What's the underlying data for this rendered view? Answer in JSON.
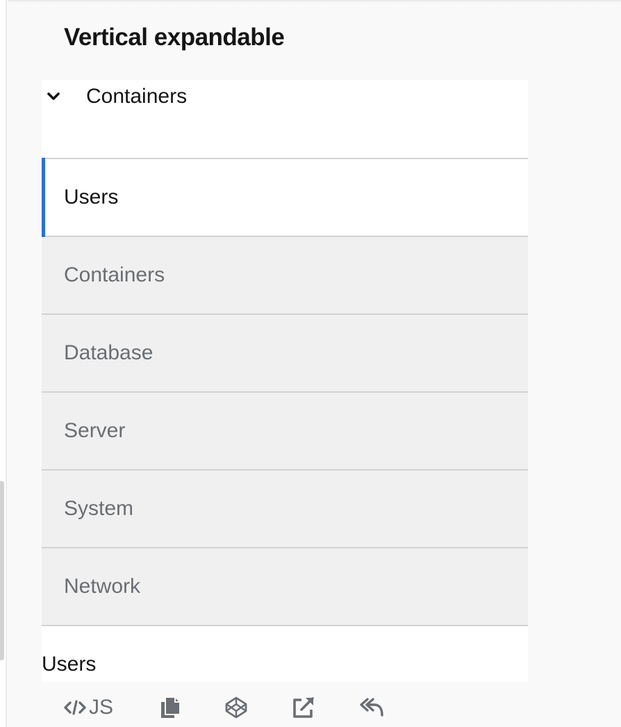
{
  "section": {
    "title": "Vertical expandable"
  },
  "expandable": {
    "toggle_label": "Containers",
    "expanded": true
  },
  "tabs": [
    {
      "label": "Users",
      "active": true
    },
    {
      "label": "Containers",
      "active": false
    },
    {
      "label": "Database",
      "active": false
    },
    {
      "label": "Server",
      "active": false
    },
    {
      "label": "System",
      "active": false
    },
    {
      "label": "Network",
      "active": false
    }
  ],
  "content": {
    "text": "Users"
  },
  "actions": {
    "js_label": "JS",
    "icons": [
      "code-icon",
      "copy-icon",
      "codepen-icon",
      "external-link-icon",
      "undo-icon"
    ]
  },
  "colors": {
    "accent": "#2b6fd6",
    "active_text": "#151515",
    "inactive_text": "#6a6e73",
    "inactive_background": "#f0f0f0",
    "border": "#d2d2d2"
  }
}
